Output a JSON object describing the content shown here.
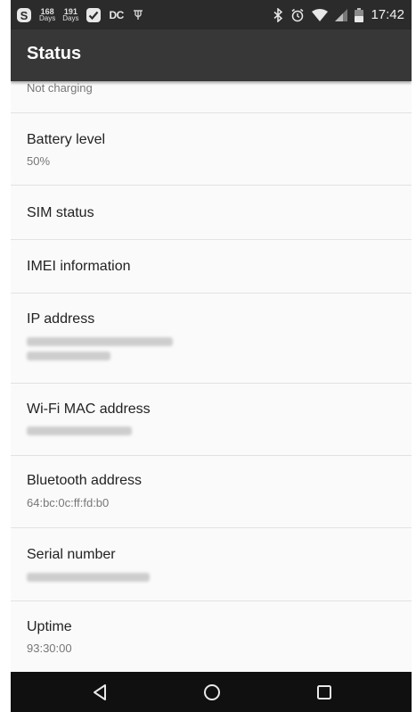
{
  "status_bar": {
    "days1": {
      "num": "168",
      "label": "Days"
    },
    "days2": {
      "num": "191",
      "label": "Days"
    },
    "dc_label": "DC",
    "time": "17:42"
  },
  "app_bar": {
    "title": "Status"
  },
  "list": {
    "items": [
      {
        "title": "",
        "subtitle": "Not charging"
      },
      {
        "title": "Battery level",
        "subtitle": "50%"
      },
      {
        "title": "SIM status",
        "subtitle": ""
      },
      {
        "title": "IMEI information",
        "subtitle": ""
      },
      {
        "title": "IP address",
        "subtitle": ""
      },
      {
        "title": "Wi-Fi MAC address",
        "subtitle": ""
      },
      {
        "title": "Bluetooth address",
        "subtitle": "64:bc:0c:ff:fd:b0"
      },
      {
        "title": "Serial number",
        "subtitle": ""
      },
      {
        "title": "Uptime",
        "subtitle": "93:30:00"
      }
    ]
  },
  "nav_bar": {
    "back_icon": "triangle-back",
    "home_icon": "circle-home",
    "recents_icon": "square-recents"
  },
  "colors": {
    "status_bar": "#2b2b2b",
    "app_bar": "#373737",
    "background": "#fafafa",
    "nav_bar": "#101010"
  }
}
